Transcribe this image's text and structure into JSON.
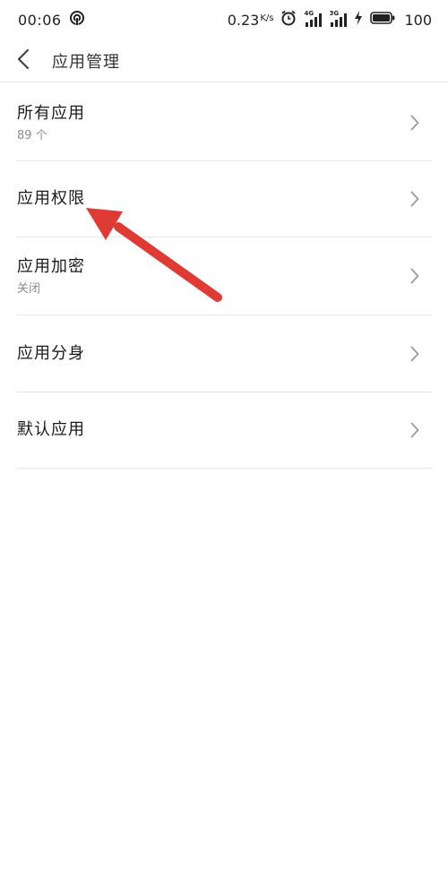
{
  "status_bar": {
    "time": "00:06",
    "speed_value": "0.23",
    "speed_unit": "K/s",
    "net_1": "4G",
    "net_2": "3G",
    "battery": "100"
  },
  "header": {
    "title": "应用管理"
  },
  "menu": {
    "items": [
      {
        "label": "所有应用",
        "sub": "89 个"
      },
      {
        "label": "应用权限"
      },
      {
        "label": "应用加密",
        "sub": "关闭"
      },
      {
        "label": "应用分身"
      },
      {
        "label": "默认应用"
      }
    ]
  },
  "colors": {
    "annotation_arrow": "#e03a34",
    "chevron": "#9a9a9a",
    "divider": "#e6e6e6"
  }
}
